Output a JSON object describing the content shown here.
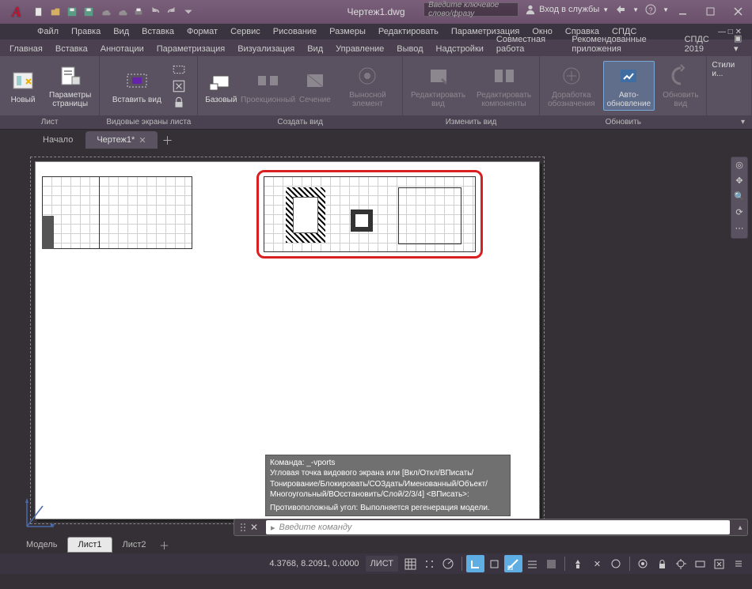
{
  "title": "Чертеж1.dwg",
  "search_placeholder": "Введите ключевое слово/фразу",
  "auth": {
    "label": "Вход в службы",
    "icon": "user"
  },
  "menus": [
    "Файл",
    "Правка",
    "Вид",
    "Вставка",
    "Формат",
    "Сервис",
    "Рисование",
    "Размеры",
    "Редактировать",
    "Параметризация",
    "Окно",
    "Справка",
    "СПДС"
  ],
  "ribbon_tabs": [
    "Главная",
    "Вставка",
    "Аннотации",
    "Параметризация",
    "Визуализация",
    "Вид",
    "Управление",
    "Вывод",
    "Надстройки",
    "Совместная работа",
    "Рекомендованные приложения",
    "СПДС 2019"
  ],
  "panels": {
    "sheet": {
      "title": "Лист",
      "new": "Новый",
      "pagesetup": "Параметры\nстраницы"
    },
    "lvp": {
      "title": "Видовые экраны листа",
      "insert": "Вставить вид"
    },
    "create": {
      "title": "Создать вид",
      "base": "Базовый",
      "proj": "Проекционный",
      "sect": "Сечение",
      "detail": "Выносной элемент"
    },
    "edit": {
      "title": "Изменить вид",
      "ev": "Редактировать\nвид",
      "ec": "Редактировать\nкомпоненты"
    },
    "update": {
      "title": "Обновить",
      "sym": "Доработка\nобозначения",
      "aut": "Авто-\nобновление",
      "upd": "Обновить\nвид"
    },
    "styles": {
      "title": " ",
      "lbl": "Стили и..."
    }
  },
  "doc_tabs": {
    "start": "Начало",
    "active": "Чертеж1*"
  },
  "cmd": {
    "l1": "Команда: _-vports",
    "l2": "Угловая точка видового экрана или [Вкл/Откл/ВПисать/",
    "l3": "Тонирование/Блокировать/СОЗдать/Именованный/Объект/",
    "l4": "Многоугольный/ВОсстановить/Слой/2/3/4] <ВПисать>:",
    "l5": "Противоположный угол: Выполняется регенерация модели.",
    "placeholder": "Введите команду"
  },
  "layout_tabs": {
    "model": "Модель",
    "s1": "Лист1",
    "s2": "Лист2"
  },
  "status": {
    "coords": "4.3768, 8.2091, 0.0000",
    "mode": "ЛИСТ"
  }
}
